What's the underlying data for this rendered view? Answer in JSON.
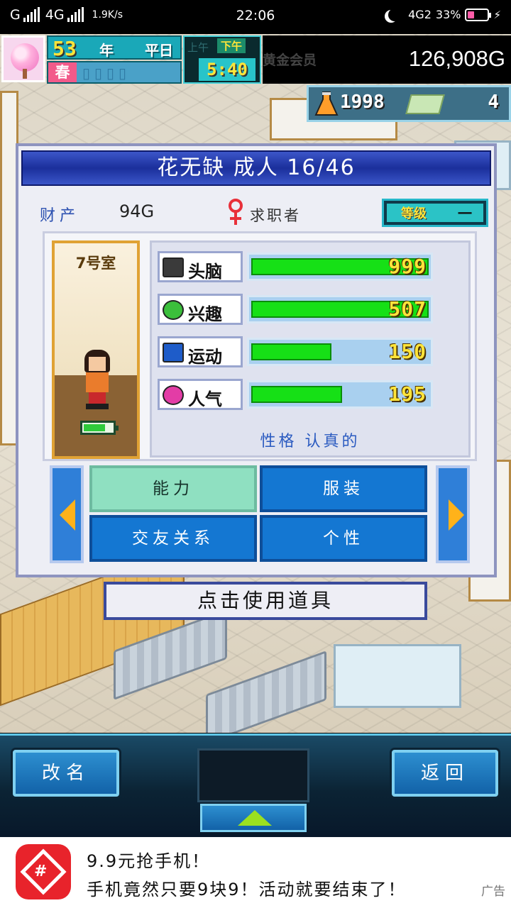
{
  "status_bar": {
    "carrier": "G",
    "network": "4G",
    "speed": "1.9K/s",
    "time": "22:06",
    "network2": "4G2",
    "battery": "33%",
    "battery_level": 0.33
  },
  "hud": {
    "year_number": "53",
    "year_unit": "年",
    "weekday": "平日",
    "season": "春",
    "am_label": "上午",
    "pm_label": "下午",
    "clock": "5:40",
    "member_label": "黄金会员",
    "money": "126,908G",
    "research_points": "1998",
    "coins": "4"
  },
  "dialog": {
    "title": "花无缺 成人 16/46",
    "asset_label": "财产",
    "asset_value": "94G",
    "status": "求职者",
    "level_label": "等级",
    "level_value": "一",
    "room_name": "7号室",
    "energy_level": 0.75,
    "stats": [
      {
        "name": "头脑",
        "value": "999",
        "fill": 1.0,
        "icon": "brain-tv-icon"
      },
      {
        "name": "兴趣",
        "value": "507",
        "fill": 1.0,
        "icon": "speech-bubble-icon"
      },
      {
        "name": "运动",
        "value": "150",
        "fill": 0.45,
        "icon": "runner-icon"
      },
      {
        "name": "人气",
        "value": "195",
        "fill": 0.51,
        "icon": "sparkle-icon"
      }
    ],
    "personality": "性格 认真的",
    "tabs": {
      "ability": "能力",
      "clothing": "服装",
      "friends": "交友关系",
      "personality": "个性"
    }
  },
  "use_item": "点击使用道具",
  "bottom_bar": {
    "rename": "改名",
    "back": "返回"
  },
  "ad": {
    "title": "9.9元抢手机！",
    "desc": "手机竟然只要9块9！活动就要结束了！",
    "tag": "广告"
  },
  "colors": {
    "title_blue": "#1b2f9b",
    "bar_green": "#16e016",
    "tab_blue": "#1477d2",
    "tab_active": "#8fe0c1",
    "value_yellow": "#ffe43a"
  }
}
